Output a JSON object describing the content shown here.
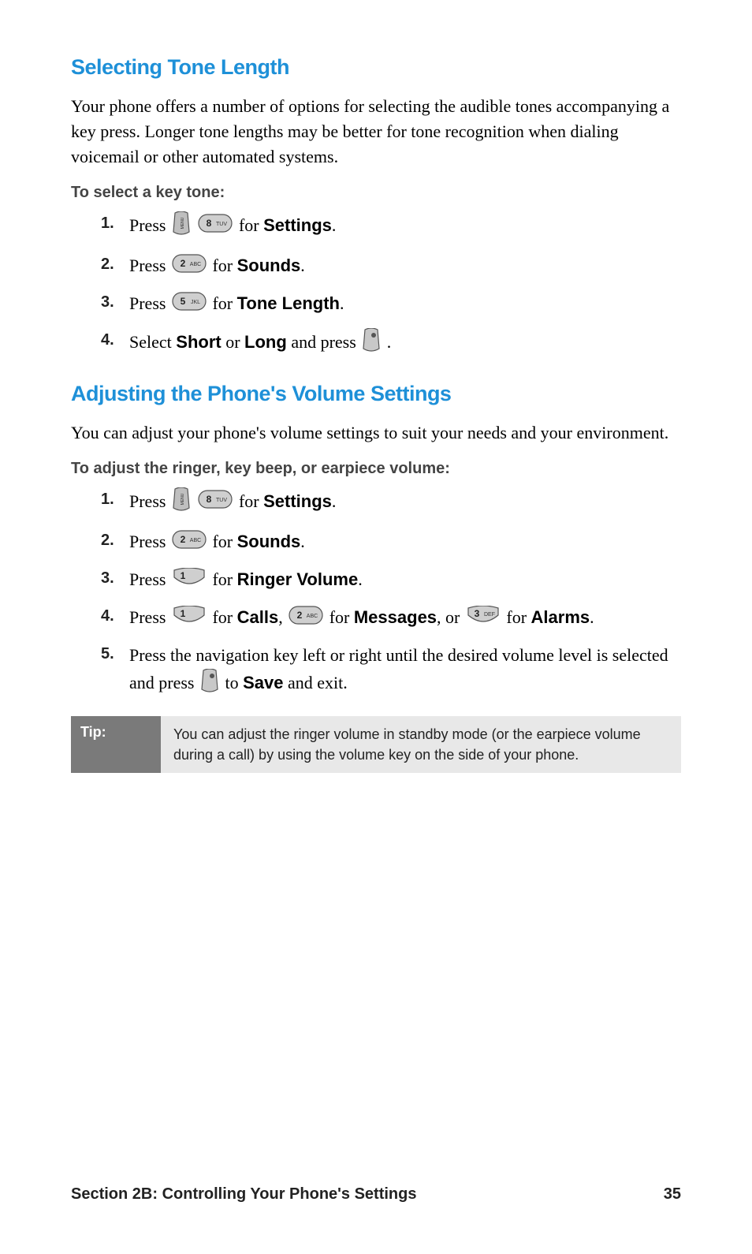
{
  "section1": {
    "heading": "Selecting Tone Length",
    "intro": "Your phone offers a number of options for selecting the audible tones accompanying a key press. Longer tone lengths may be better for tone recognition when dialing voicemail or other automated systems.",
    "subhead": "To select a key tone:",
    "steps": {
      "n1": "1.",
      "s1a": "Press ",
      "s1b": " for ",
      "s1c": "Settings",
      "s1d": ".",
      "n2": "2.",
      "s2a": "Press ",
      "s2b": " for ",
      "s2c": "Sounds",
      "s2d": ".",
      "n3": "3.",
      "s3a": "Press ",
      "s3b": " for ",
      "s3c": "Tone Length",
      "s3d": ".",
      "n4": "4.",
      "s4a": "Select ",
      "s4b": "Short",
      "s4c": " or ",
      "s4d": "Long",
      "s4e": " and press ",
      "s4f": "."
    }
  },
  "section2": {
    "heading": "Adjusting the Phone's Volume Settings",
    "intro": "You can adjust your phone's volume settings to suit your needs and your environment.",
    "subhead": "To adjust the ringer, key beep, or earpiece volume:",
    "steps": {
      "n1": "1.",
      "s1a": "Press ",
      "s1b": " for ",
      "s1c": "Settings",
      "s1d": ".",
      "n2": "2.",
      "s2a": "Press ",
      "s2b": " for ",
      "s2c": "Sounds",
      "s2d": ".",
      "n3": "3.",
      "s3a": "Press ",
      "s3b": " for ",
      "s3c": "Ringer Volume",
      "s3d": ".",
      "n4": "4.",
      "s4a": "Press ",
      "s4b": " for ",
      "s4c": "Calls",
      "s4d": ", ",
      "s4e": " for ",
      "s4f": "Messages",
      "s4g": ", or ",
      "s4h": " for ",
      "s4i": "Alarms",
      "s4j": ".",
      "n5": "5.",
      "s5a": "Press the navigation key left or right until the desired volume level is selected and press ",
      "s5b": " to ",
      "s5c": "Save",
      "s5d": " and exit."
    }
  },
  "tip": {
    "label": "Tip:",
    "text": "You can adjust the ringer volume in standby mode (or the earpiece volume during a call) by using the volume key on the side of your phone."
  },
  "footer": {
    "section": "Section 2B: Controlling Your Phone's Settings",
    "page": "35"
  },
  "keys": {
    "menu": "MENU",
    "8": "8 TUV",
    "2": "2 ABC",
    "5": "5 JKL",
    "1": "1",
    "3": "3 DEF",
    "ok": "OK"
  }
}
